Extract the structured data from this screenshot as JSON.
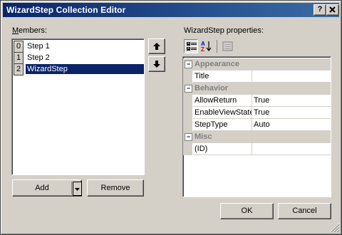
{
  "window": {
    "title": "WizardStep Collection Editor",
    "help_label": "?",
    "close_label": "X"
  },
  "members": {
    "label": "Members:",
    "items": [
      {
        "index": "0",
        "name": "Step 1"
      },
      {
        "index": "1",
        "name": "Step 2"
      },
      {
        "index": "2",
        "name": "WizardStep"
      }
    ],
    "move_up_icon": "up-arrow-icon",
    "move_down_icon": "down-arrow-icon",
    "add_label": "Add",
    "remove_label": "Remove"
  },
  "properties": {
    "label": "WizardStep properties:",
    "toolbar": [
      "categorized-icon",
      "alphabetical-icon",
      "property-pages-icon"
    ],
    "categories": [
      {
        "name": "Appearance",
        "rows": [
          {
            "name": "Title",
            "value": ""
          }
        ]
      },
      {
        "name": "Behavior",
        "rows": [
          {
            "name": "AllowReturn",
            "value": "True"
          },
          {
            "name": "EnableViewState",
            "value": "True"
          },
          {
            "name": "StepType",
            "value": "Auto"
          }
        ]
      },
      {
        "name": "Misc",
        "rows": [
          {
            "name": "(ID)",
            "value": ""
          }
        ]
      }
    ],
    "collapse_symbol": "−"
  },
  "buttons": {
    "ok": "OK",
    "cancel": "Cancel"
  },
  "colors": {
    "title_start": "#0a246a",
    "title_end": "#3a6ea5",
    "selection": "#0a246a",
    "face": "#d4d0c8"
  }
}
